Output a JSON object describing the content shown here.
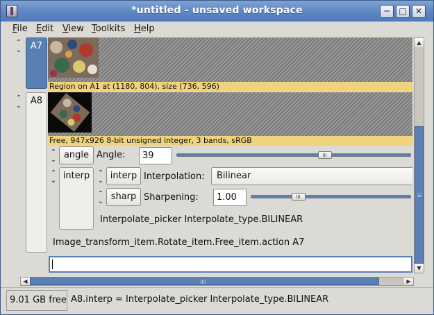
{
  "window": {
    "title": "*untitled - unsaved workspace",
    "controls": {
      "minimize": "─",
      "maximize": "□",
      "close": "✕"
    }
  },
  "menu": {
    "file": {
      "mnemonic": "F",
      "rest": "ile"
    },
    "edit": {
      "mnemonic": "E",
      "rest": "dit"
    },
    "view": {
      "mnemonic": "V",
      "rest": "iew"
    },
    "toolkits": {
      "mnemonic": "T",
      "rest": "oolkits"
    },
    "help": {
      "mnemonic": "H",
      "rest": "elp"
    }
  },
  "rows": {
    "a7": {
      "tab": "A7",
      "caption": "Region on A1 at (1180, 804), size (736, 596)"
    },
    "a8": {
      "tab": "A8",
      "caption": "Free, 947x926 8-bit unsigned integer, 3 bands, sRGB",
      "angle": {
        "button": "angle",
        "label": "Angle:",
        "value": "39",
        "slider_fraction": 0.64
      },
      "interp": {
        "tab": "interp",
        "button": "interp",
        "label": "Interpolation:",
        "value": "Bilinear",
        "sharp": {
          "button": "sharp",
          "label": "Sharpening:",
          "value": "1.00",
          "slider_fraction": 0.28
        },
        "description": "Interpolate_picker Interpolate_type.BILINEAR"
      },
      "description": "Image_transform_item.Rotate_item.Free_item.action A7"
    }
  },
  "command_input": {
    "value": ""
  },
  "icons": {
    "expand": "up-down-chevron-icon",
    "app": "app-icon"
  },
  "status": {
    "free": "9.01 GB free",
    "message": "A8.interp = Interpolate_picker Interpolate_type.BILINEAR"
  },
  "colors": {
    "titlebar": "#5c86c4",
    "selected_tab": "#5a7fb3",
    "caption_bg": "#f0d37c",
    "scroll_thumb": "#5b80b6"
  }
}
